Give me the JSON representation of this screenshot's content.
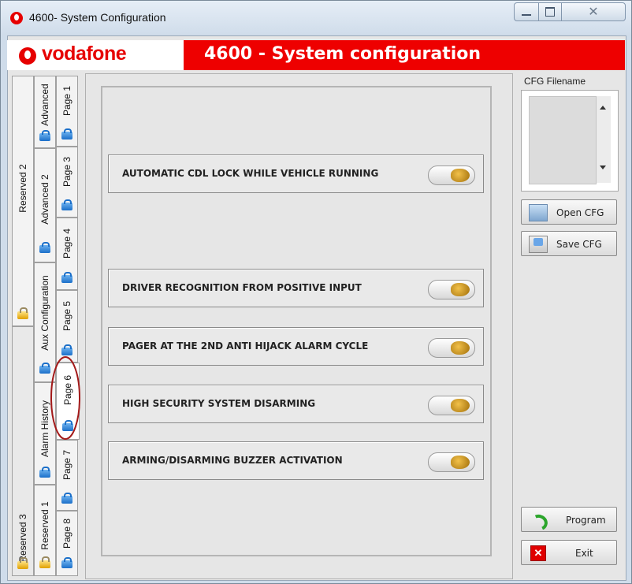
{
  "window": {
    "title": "4600-  System Configuration",
    "close_glyph": "✕"
  },
  "header": {
    "brand": "vodafone",
    "title": "4600 - System configuration",
    "accent_color": "#ee0000"
  },
  "tabs": {
    "outer": [
      {
        "label": "Reserved 2",
        "icon": "lock-icon"
      },
      {
        "label": "Reserved 3",
        "icon": "lock-icon"
      }
    ],
    "middle": [
      {
        "label": "Advanced",
        "icon": "toolbox-icon"
      },
      {
        "label": "Advanced 2",
        "icon": "toolbox-icon"
      },
      {
        "label": "Aux Configuration",
        "icon": "toolbox-icon"
      },
      {
        "label": "Alarm History",
        "icon": "toolbox-icon"
      },
      {
        "label": "Reserved 1",
        "icon": "lock-icon"
      }
    ],
    "inner": [
      {
        "label": "Page 1"
      },
      {
        "label": "Page 3"
      },
      {
        "label": "Page 4"
      },
      {
        "label": "Page 5"
      },
      {
        "label": "Page 6",
        "selected": true
      },
      {
        "label": "Page 7"
      },
      {
        "label": "Page 8"
      }
    ]
  },
  "options": [
    {
      "label": "AUTOMATIC CDL LOCK WHILE VEHICLE RUNNING",
      "state": "off"
    },
    {
      "label": "DRIVER RECOGNITION FROM POSITIVE INPUT",
      "state": "off"
    },
    {
      "label": "PAGER AT THE 2ND ANTI HIJACK ALARM CYCLE",
      "state": "off"
    },
    {
      "label": "HIGH SECURITY SYSTEM DISARMING",
      "state": "off"
    },
    {
      "label": "ARMING/DISARMING BUZZER ACTIVATION",
      "state": "off"
    }
  ],
  "sidepanel": {
    "cfg_label": "CFG Filename",
    "open_label": "Open CFG",
    "save_label": "Save CFG",
    "program_label": "Program",
    "exit_label": "Exit",
    "exit_glyph": "✕"
  }
}
